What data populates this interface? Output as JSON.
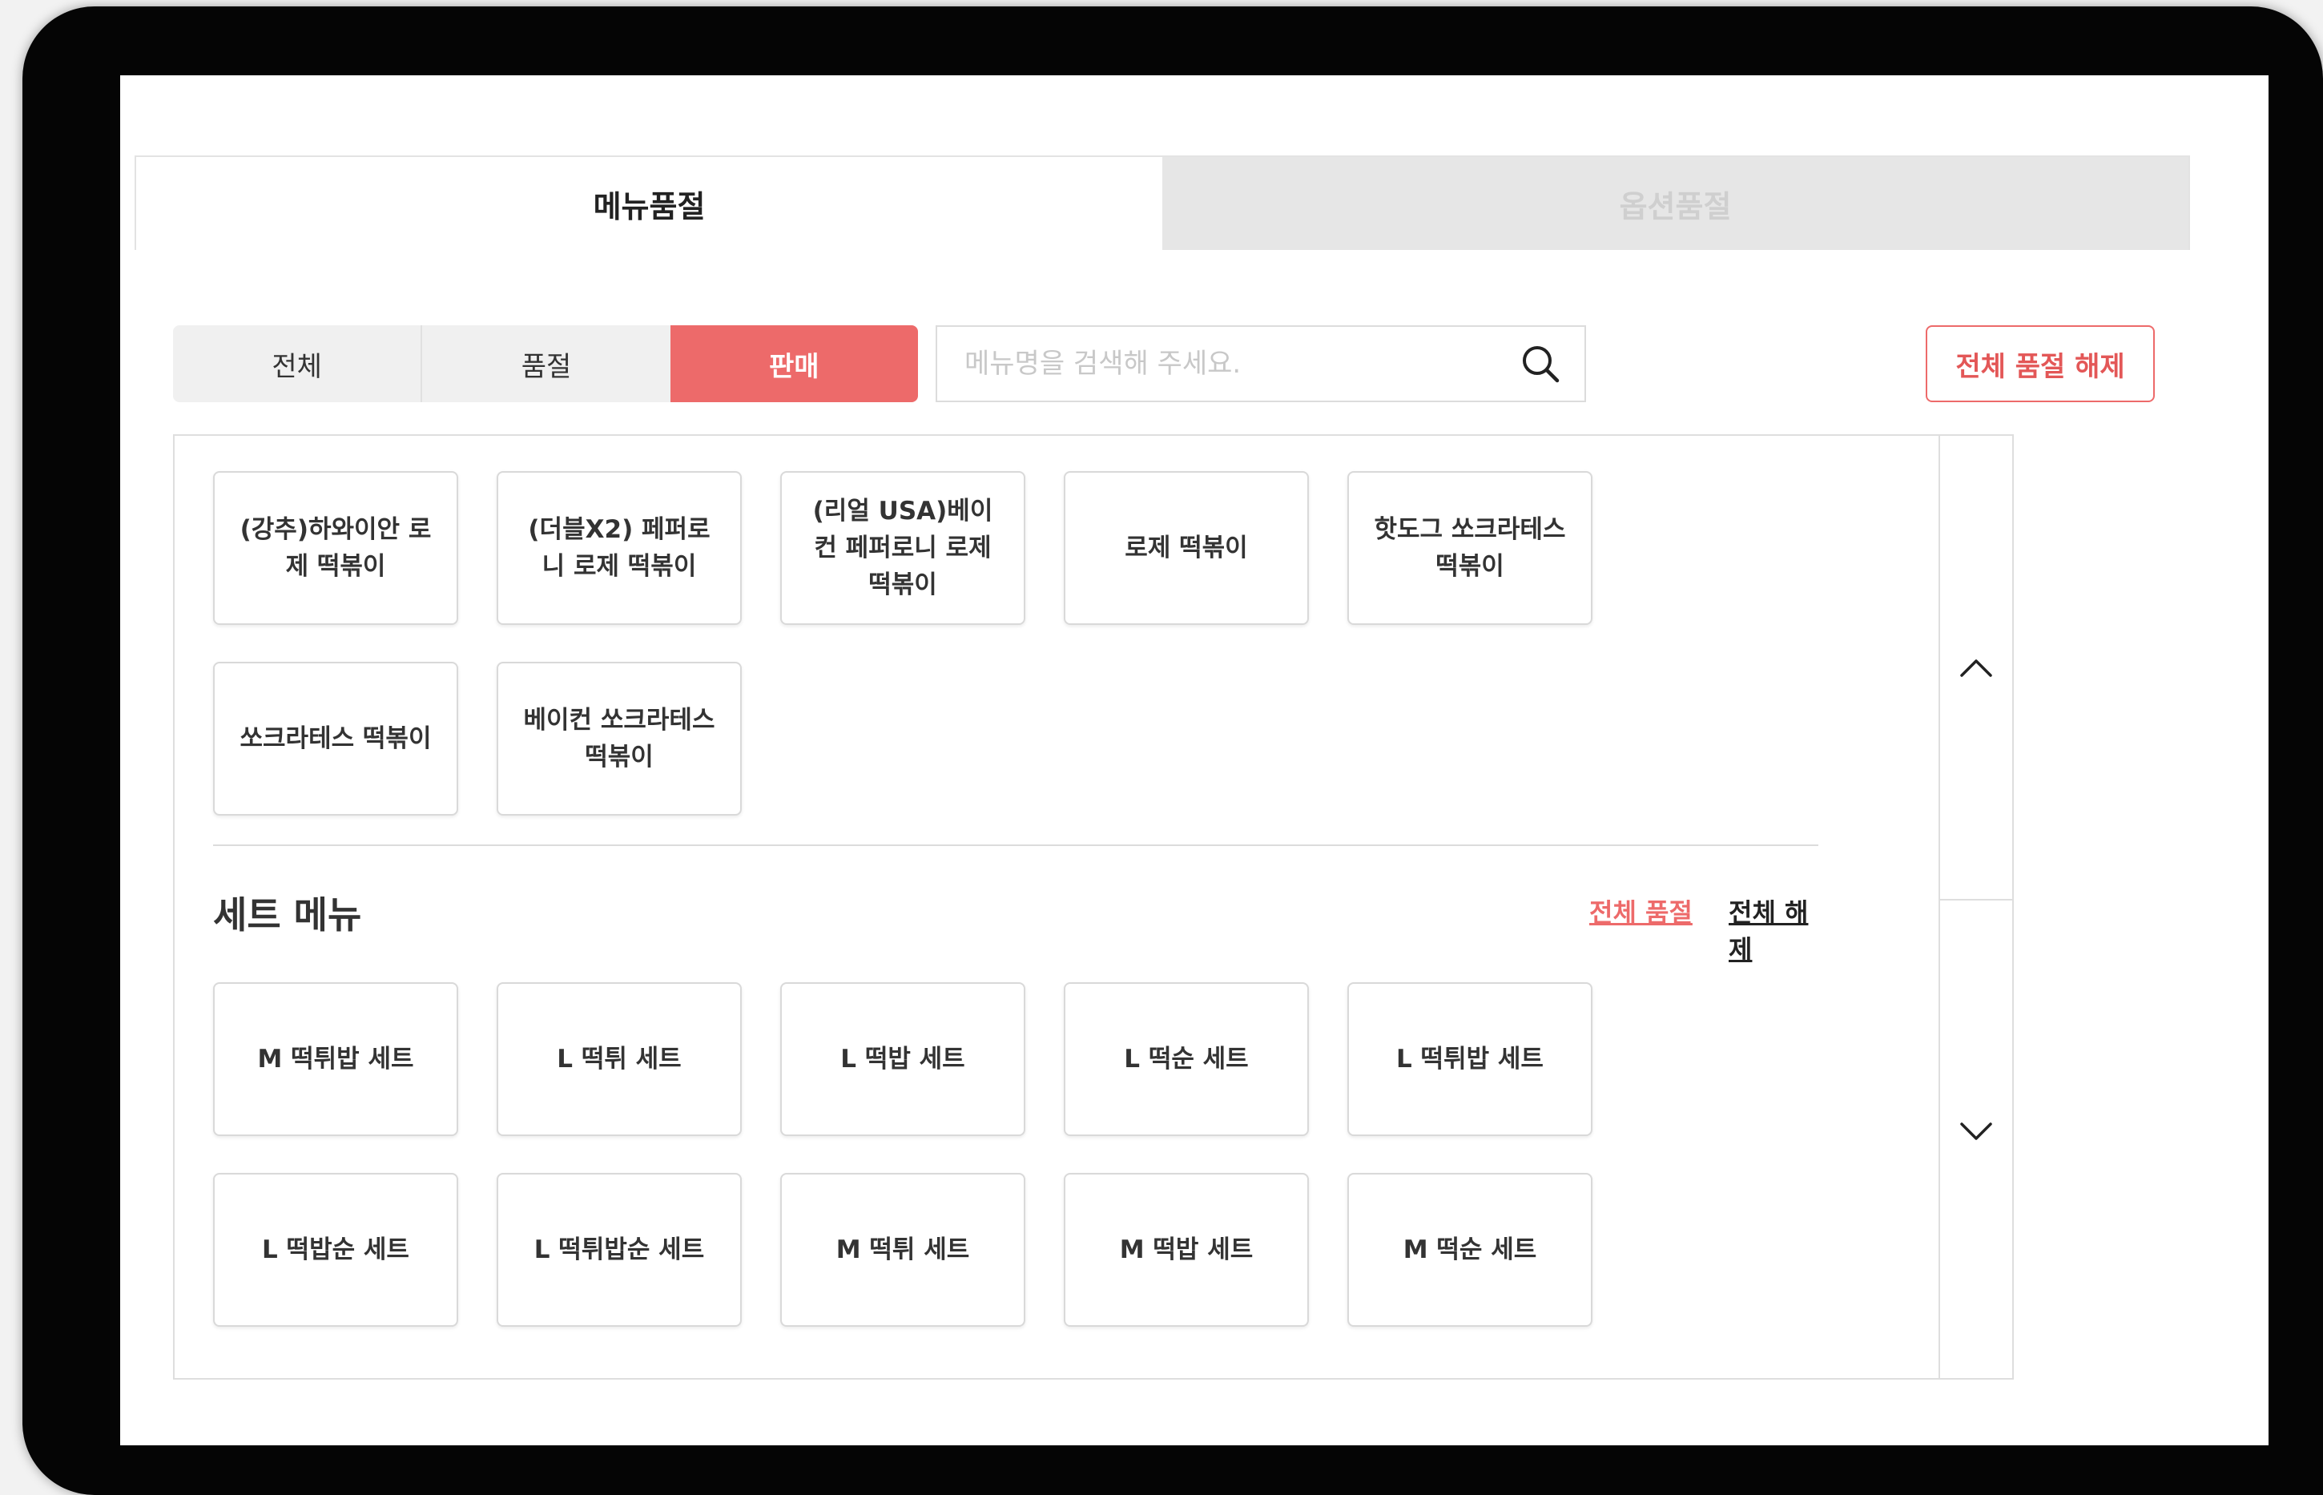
{
  "tabs": [
    {
      "label": "메뉴품절",
      "active": true
    },
    {
      "label": "옵션품절",
      "active": false
    }
  ],
  "filter": {
    "options": [
      "전체",
      "품절",
      "판매"
    ],
    "selected": "판매"
  },
  "search": {
    "placeholder": "메뉴명을 검색해 주세요.",
    "value": ""
  },
  "release_all_button": "전체 품절 해제",
  "menu_items": [
    "(강추)하와이안 로제 떡볶이",
    "(더블X2) 페퍼로니 로제 떡볶이",
    "(리얼 USA)베이컨 페퍼로니 로제 떡볶이",
    "로제 떡볶이",
    "핫도그 쏘크라테스 떡볶이",
    "쏘크라테스 떡볶이",
    "베이컨 쏘크라테스 떡볶이"
  ],
  "set_section": {
    "title": "세트 메뉴",
    "soldout_all_link": "전체 품절",
    "release_all_link": "전체 해제",
    "items": [
      "M 떡튀밥 세트",
      "L 떡튀 세트",
      "L 떡밥 세트",
      "L 떡순 세트",
      "L 떡튀밥 세트",
      "L 떡밥순 세트",
      "L 떡튀밥순 세트",
      "M 떡튀 세트",
      "M 떡밥 세트",
      "M 떡순 세트"
    ]
  },
  "colors": {
    "accent": "#ed6a6a",
    "inactive_tab": "#e6e6e6"
  },
  "icons": {
    "search": "search-icon",
    "scroll_up": "chevron-up-icon",
    "scroll_down": "chevron-down-icon"
  }
}
